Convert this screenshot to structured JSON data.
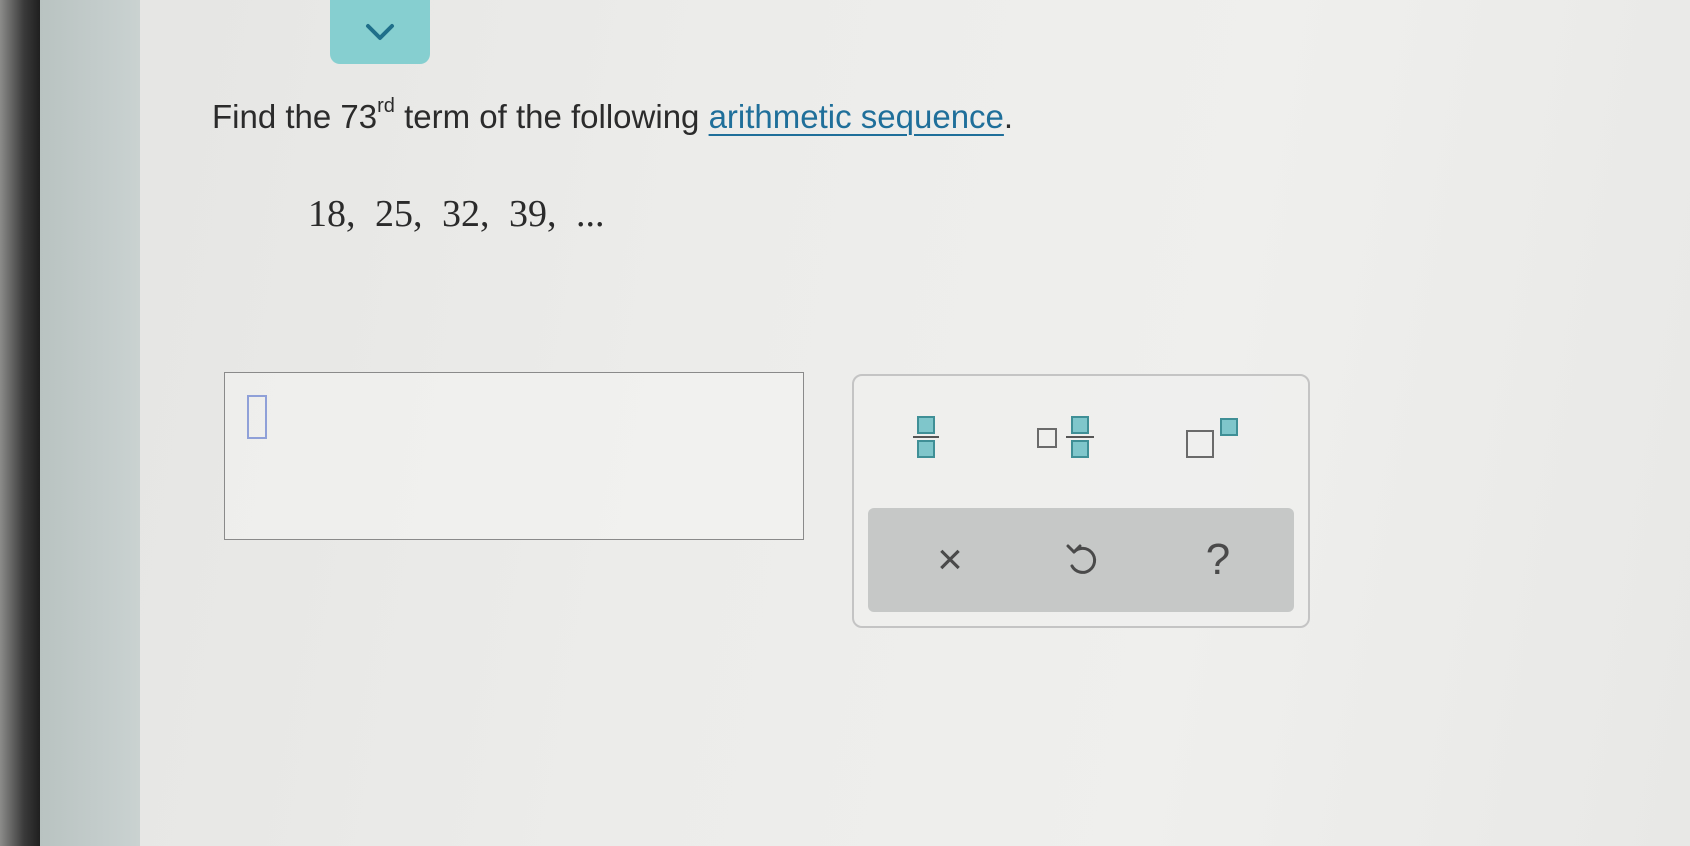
{
  "question": {
    "prefix": "Find the 73",
    "ordinal_suffix": "rd",
    "middle": " term of the following ",
    "link_text": "arithmetic sequence",
    "end": "."
  },
  "sequence": "18,  25,  32,  39,  ...",
  "toolbar": {
    "collapse_icon": "chevron-down-icon",
    "templates": [
      "fraction-icon",
      "mixed-number-icon",
      "superscript-icon"
    ],
    "actions": {
      "clear": "×",
      "undo_icon": "undo-icon",
      "help": "?"
    }
  },
  "colors": {
    "accent": "#86cfd0",
    "link": "#1f6f9a",
    "template_fill": "#7fc6cb"
  }
}
